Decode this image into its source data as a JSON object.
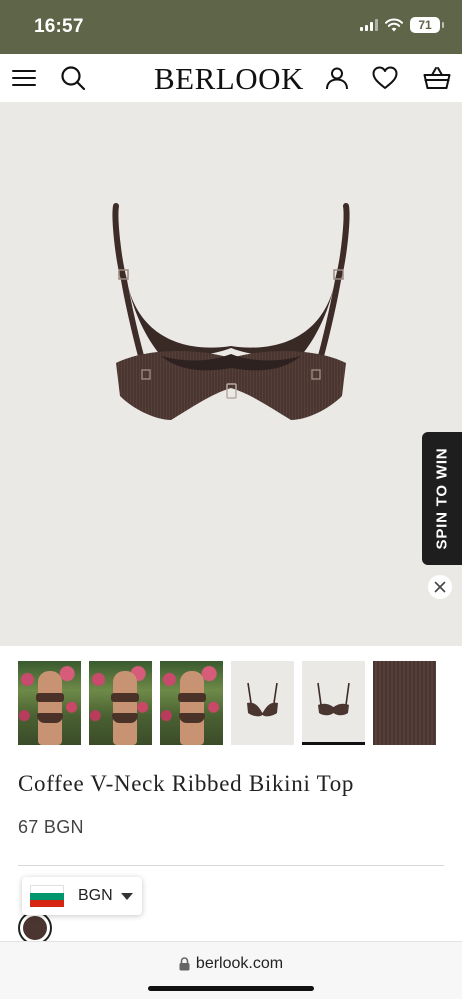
{
  "status_bar": {
    "time": "16:57",
    "battery": "71",
    "icons": [
      "signal-icon",
      "wifi-icon",
      "battery-icon"
    ]
  },
  "header": {
    "logo": "BERLOOK",
    "icons": [
      "menu-icon",
      "search-icon",
      "account-icon",
      "wishlist-heart-icon",
      "cart-basket-icon"
    ]
  },
  "promo": {
    "spin_label": "SPIN TO WIN",
    "close_icon": "close-icon"
  },
  "gallery": {
    "thumbnails": [
      {
        "kind": "lifestyle-photo"
      },
      {
        "kind": "lifestyle-photo"
      },
      {
        "kind": "lifestyle-photo"
      },
      {
        "kind": "product-front"
      },
      {
        "kind": "product-back",
        "selected": true
      },
      {
        "kind": "fabric-texture"
      }
    ]
  },
  "product": {
    "title": "Coffee V-Neck Ribbed Bikini Top",
    "price": "67 BGN",
    "color_swatch": "#4a3530"
  },
  "currency_selector": {
    "code": "BGN",
    "flag_colors": [
      "#ffffff",
      "#00966e",
      "#d62612"
    ]
  },
  "browser": {
    "url": "berlook.com",
    "lock_icon": "lock-icon"
  },
  "colors": {
    "status_bar": "#5f6549",
    "hero_bg": "#ebe9e6",
    "product_brown": "#4a3530"
  }
}
